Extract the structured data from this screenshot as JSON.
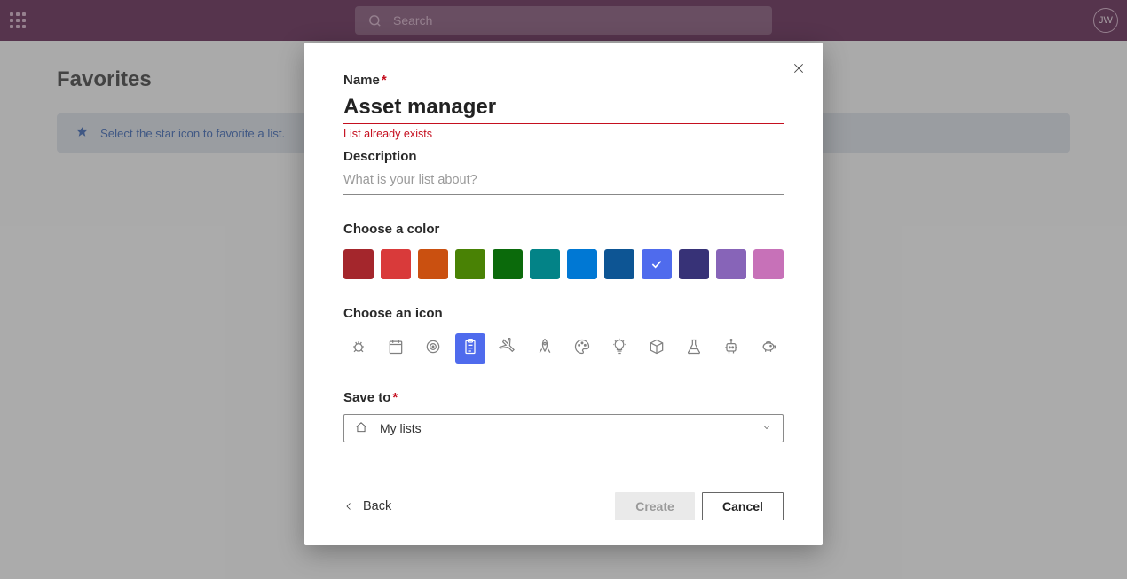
{
  "header": {
    "search_placeholder": "Search",
    "avatar_initials": "JW"
  },
  "page": {
    "title": "Favorites",
    "hint_text": "Select the star icon to favorite a list."
  },
  "modal": {
    "name_label": "Name",
    "name_value": "Asset manager",
    "name_error": "List already exists",
    "description_label": "Description",
    "description_placeholder": "What is your list about?",
    "color_label": "Choose a color",
    "colors": [
      {
        "name": "dark-red",
        "hex": "#a4262c"
      },
      {
        "name": "red",
        "hex": "#d93a3a"
      },
      {
        "name": "orange",
        "hex": "#ca5010"
      },
      {
        "name": "green",
        "hex": "#498205"
      },
      {
        "name": "dark-green",
        "hex": "#0b6a0b"
      },
      {
        "name": "teal",
        "hex": "#038387"
      },
      {
        "name": "blue",
        "hex": "#0078d4"
      },
      {
        "name": "dark-blue",
        "hex": "#0d5594"
      },
      {
        "name": "cornflower",
        "hex": "#4f6bed",
        "selected": true
      },
      {
        "name": "navy",
        "hex": "#373277"
      },
      {
        "name": "purple",
        "hex": "#8764b8"
      },
      {
        "name": "pink",
        "hex": "#c771b8"
      }
    ],
    "icon_label": "Choose an icon",
    "icons": [
      {
        "name": "bug-icon"
      },
      {
        "name": "calendar-icon"
      },
      {
        "name": "target-icon"
      },
      {
        "name": "clipboard-icon",
        "selected": true
      },
      {
        "name": "airplane-icon"
      },
      {
        "name": "rocket-icon"
      },
      {
        "name": "palette-icon"
      },
      {
        "name": "lightbulb-icon"
      },
      {
        "name": "cube-icon"
      },
      {
        "name": "flask-icon"
      },
      {
        "name": "robot-icon"
      },
      {
        "name": "piggybank-icon"
      }
    ],
    "save_label": "Save to",
    "save_value": "My lists",
    "back_label": "Back",
    "create_label": "Create",
    "cancel_label": "Cancel"
  }
}
